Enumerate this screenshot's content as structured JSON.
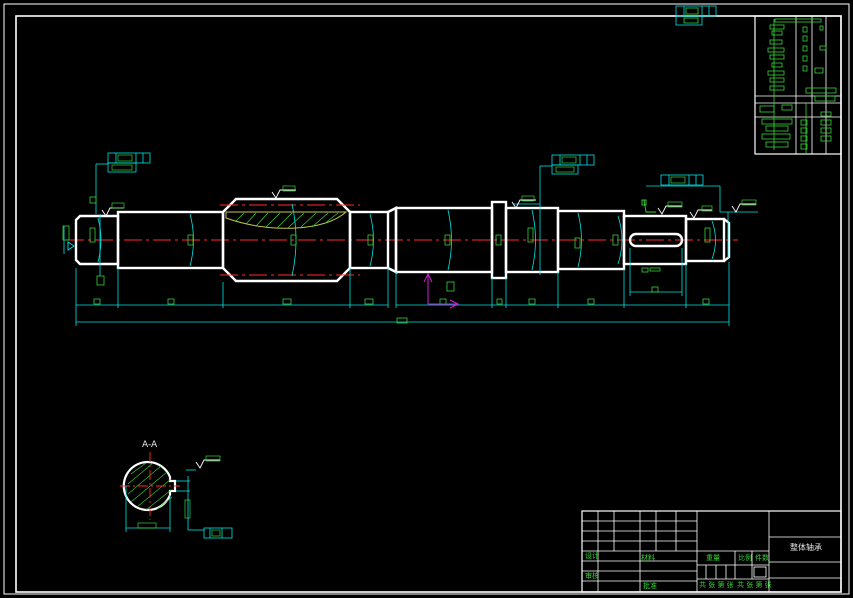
{
  "section_label": "A-A",
  "title_block": {
    "drawing_name": "整体轴承",
    "label_scale": "比例",
    "label_qty": "件数",
    "label_weight": "重量",
    "label_material": "材料",
    "row_design": "设计",
    "row_check": "审核",
    "row_approve": "批准",
    "sheet_info": "共  张  第  张",
    "sheet_info2": "共  张  第  张"
  },
  "colors": {
    "background": "#000000",
    "outline": "#ffffff",
    "dimension": "#00e5e5",
    "centerline": "#ff2a2a",
    "annotation": "#35d435",
    "hatch": "#c8c84a",
    "ucs": "#d020d0"
  }
}
